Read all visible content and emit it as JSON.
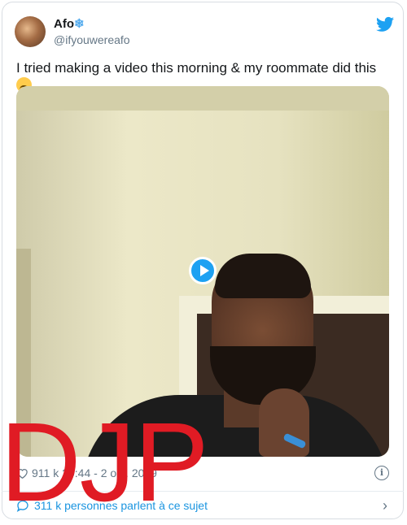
{
  "user": {
    "name": "Afo",
    "name_emoji": "❄",
    "handle": "@ifyouwereafo"
  },
  "tweet": {
    "text": "I tried making a video this morning & my roommate did this"
  },
  "meta": {
    "likes": "911 k",
    "time_date": "20:44 - 2 oct. 2019"
  },
  "footer": {
    "discussion": "311 k personnes parlent à ce sujet"
  },
  "watermark": "DJP",
  "icons": [
    "twitter-bird-icon",
    "play-icon",
    "heart-icon",
    "info-icon",
    "comment-icon",
    "chevron-right-icon"
  ],
  "colors": {
    "accent": "#1da1f2",
    "watermark": "#e01b24",
    "muted": "#657786"
  }
}
